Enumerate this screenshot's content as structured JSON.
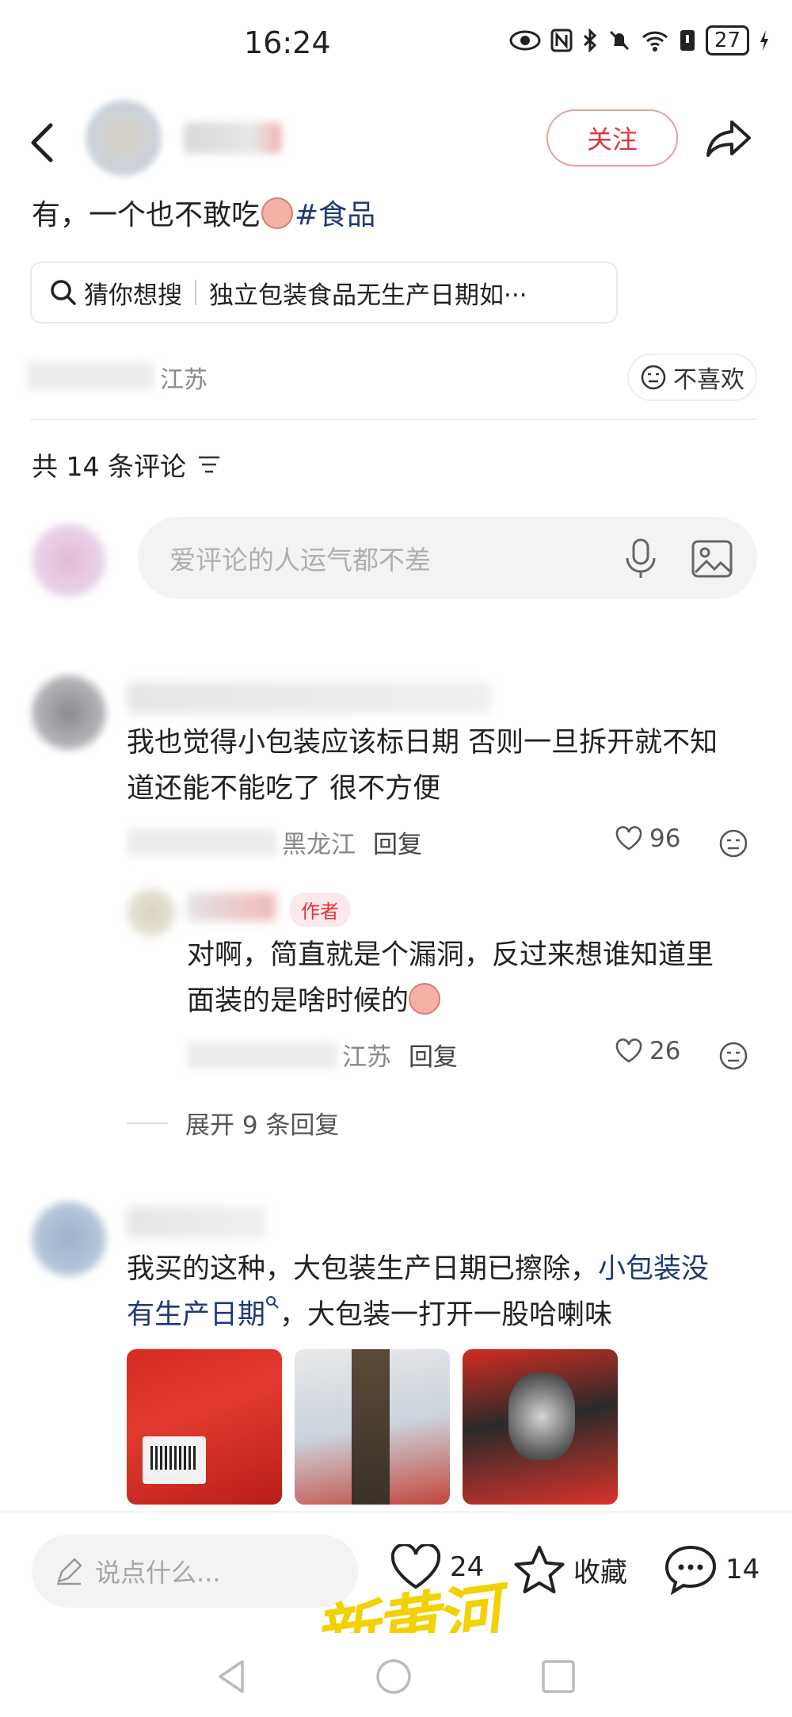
{
  "status_bar": {
    "time": "16:24",
    "battery": "27"
  },
  "header": {
    "follow_label": "关注"
  },
  "post": {
    "text_prefix": "有，一个也不敢吃",
    "hashtag": "#食品",
    "search_hint_label": "猜你想搜",
    "search_hint_query": "独立包装食品无生产日期如···",
    "location": "江苏",
    "dislike_label": "不喜欢"
  },
  "comments_section": {
    "count_label": "共 14 条评论",
    "input_placeholder": "爱评论的人运气都不差"
  },
  "comments": [
    {
      "text_line1": "我也觉得小包装应该标日期 否则一旦拆开就不知",
      "text_line2": "道还能不能吃了 很不方便",
      "location": "黑龙江",
      "reply_label": "回复",
      "likes": "96",
      "reply": {
        "badge": "作者",
        "text_line1": "对啊，简直就是个漏洞，反过来想谁知道里",
        "text_line2": "面装的是啥时候的",
        "location": "江苏",
        "reply_label": "回复",
        "likes": "26"
      },
      "expand_label": "展开 9 条回复"
    },
    {
      "text_line1_prefix": "我买的这种，大包装生产日期已擦除，",
      "text_line1_link": "小包装没",
      "text_line2_link": "有生产日期",
      "text_line2_suffix": "，大包装一打开一股哈喇味"
    }
  ],
  "bottom_bar": {
    "say_placeholder": "说点什么...",
    "likes": "24",
    "collect_label": "收藏",
    "comments": "14"
  },
  "watermark": "新黄河",
  "colors": {
    "accent_red": "#e0353f",
    "link_blue": "#1f3a77",
    "watermark_yellow": "#f3d100"
  }
}
